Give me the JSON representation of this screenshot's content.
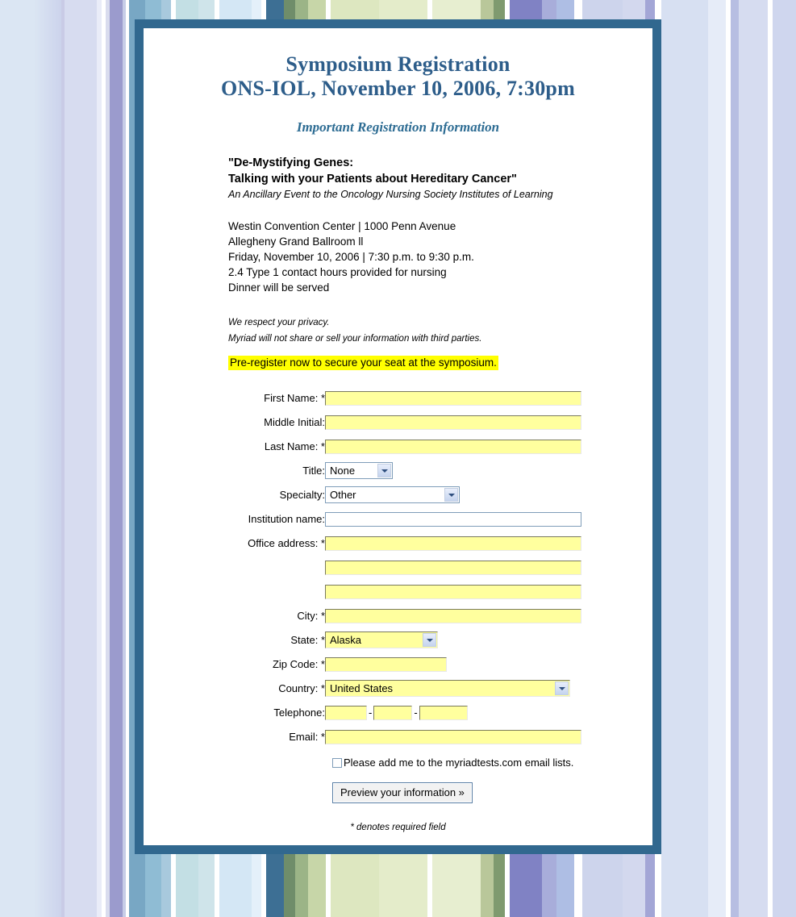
{
  "header": {
    "title_line1": "Symposium Registration",
    "title_line2": "ONS-IOL, November 10, 2006, 7:30pm",
    "subtitle": "Important Registration Information"
  },
  "event": {
    "name_line1": "\"De-Mystifying Genes:",
    "name_line2": "Talking with your Patients about Hereditary Cancer\"",
    "ancillary": "An Ancillary Event to the Oncology Nursing Society Institutes of Learning",
    "details": [
      "Westin Convention Center | 1000 Penn Avenue",
      "Allegheny Grand Ballroom ll",
      "Friday, November 10, 2006 | 7:30 p.m. to 9:30 p.m.",
      "2.4 Type 1 contact hours provided for nursing",
      "Dinner will be served"
    ],
    "privacy_line1": "We respect your privacy.",
    "privacy_line2": "Myriad will not share or sell your information with third parties.",
    "prereg": "Pre-register now to secure your seat at the symposium."
  },
  "form": {
    "fields": {
      "first_name_label": "First Name: *",
      "middle_initial_label": "Middle Initial:",
      "last_name_label": "Last Name: *",
      "title_label": "Title:",
      "specialty_label": "Specialty:",
      "institution_label": "Institution name:",
      "office_address_label": "Office address: *",
      "city_label": "City: *",
      "state_label": "State: *",
      "zip_label": "Zip Code: *",
      "country_label": "Country: *",
      "telephone_label": "Telephone:",
      "email_label": "Email: *"
    },
    "values": {
      "first_name": "",
      "middle_initial": "",
      "last_name": "",
      "title_selected": "None",
      "specialty_selected": "Other",
      "institution": "",
      "address1": "",
      "address2": "",
      "address3": "",
      "city": "",
      "state_selected": "Alaska",
      "zip": "",
      "country_selected": "United States",
      "phone_area": "",
      "phone_prefix": "",
      "phone_line": "",
      "email": ""
    },
    "phone_separator": "-",
    "checkbox_label": "Please add me to the myriadtests.com email lists.",
    "submit_label": "Preview your information  »",
    "required_note": "* denotes required field"
  },
  "colors": {
    "heading_blue": "#2d5d8a",
    "subtitle_blue": "#2d6c93",
    "panel_border": "#31688f",
    "required_field_yellow": "#ffff9e",
    "highlight_yellow": "#ffff00"
  }
}
